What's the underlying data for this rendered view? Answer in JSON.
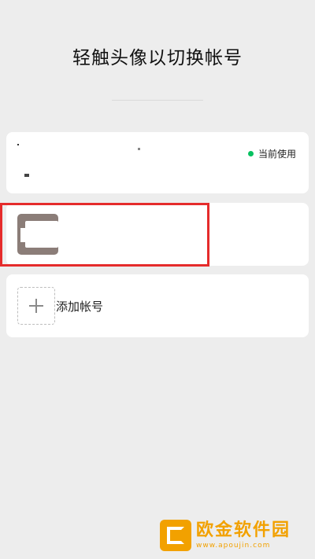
{
  "header": {
    "title": "轻触头像以切换帐号"
  },
  "accounts": {
    "current": {
      "status_label": "当前使用",
      "status_color": "#07c160"
    },
    "add_account": {
      "label": "添加帐号",
      "icon": "plus-icon"
    }
  },
  "watermark": {
    "name": "欧金软件园",
    "url": "www.apoujin.com",
    "color": "#f2a100"
  }
}
